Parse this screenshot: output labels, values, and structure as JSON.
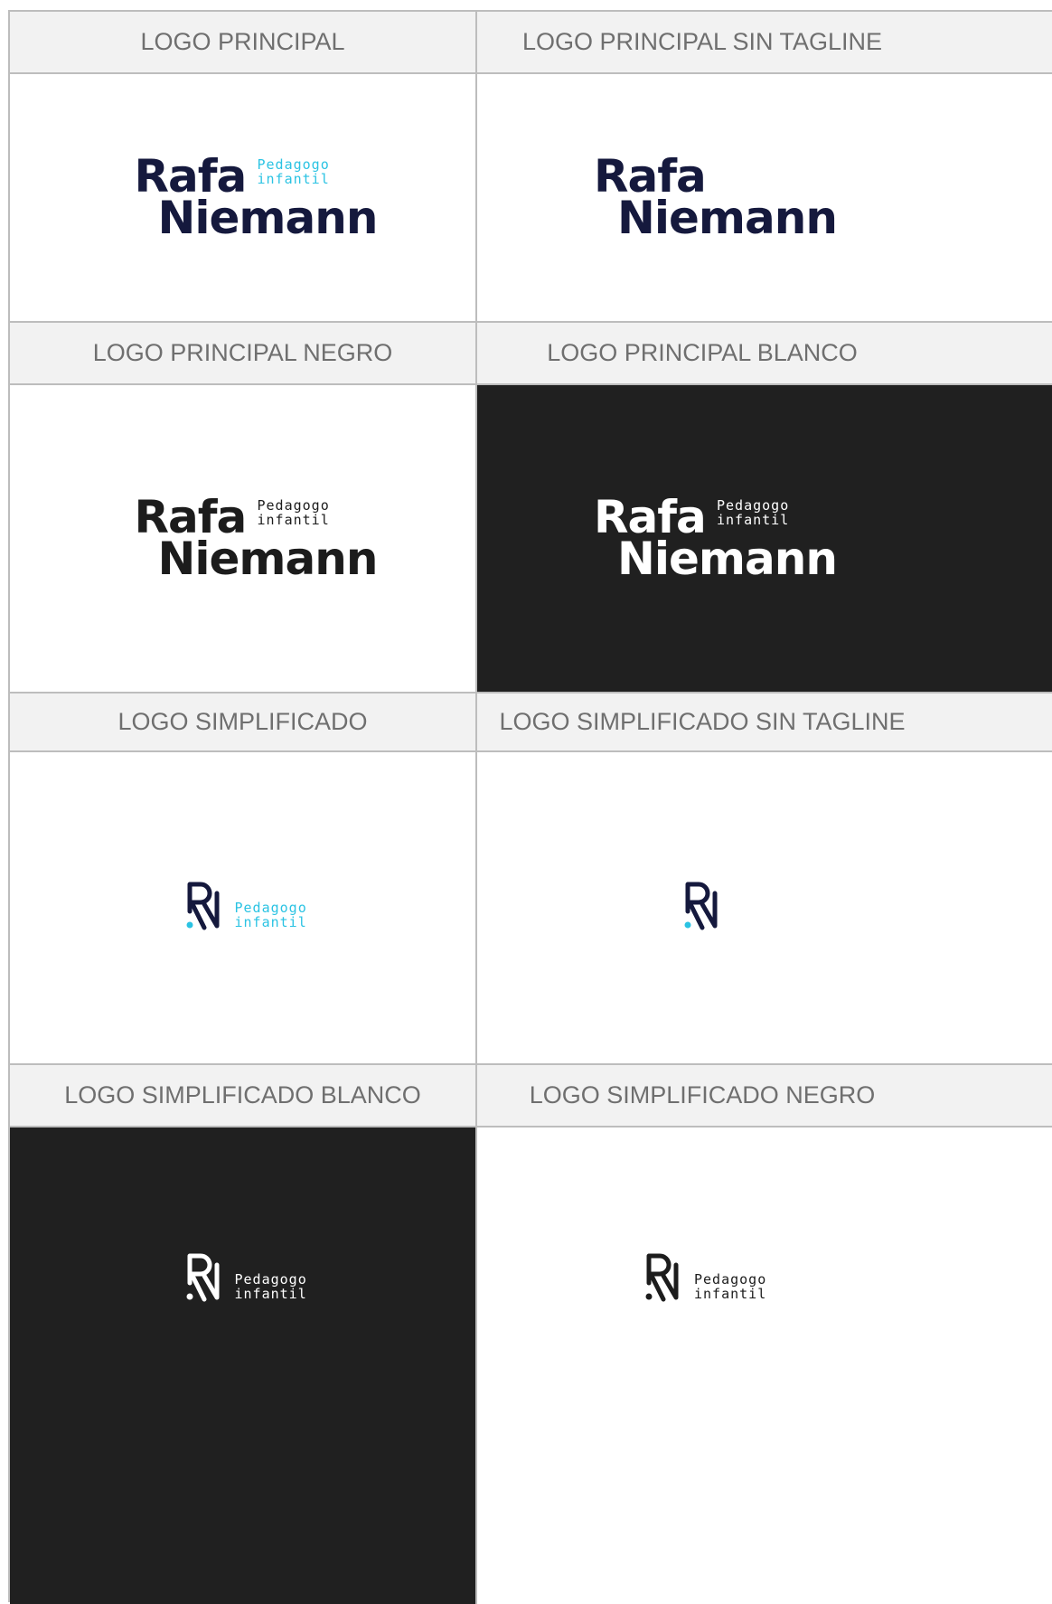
{
  "colors": {
    "navy": "#15193d",
    "cyan": "#2bc3e3",
    "black": "#1c1c1c",
    "white": "#ffffff",
    "dark_bg": "#202020",
    "header_bg": "#f2f2f2",
    "header_text": "#6f6f6f"
  },
  "logo_text": {
    "line1": "Rafa",
    "line2": "Niemann",
    "tag1": "Pedagogo",
    "tag2": "infantil"
  },
  "cells": [
    {
      "title": "LOGO PRINCIPAL"
    },
    {
      "title": "LOGO PRINCIPAL SIN TAGLINE"
    },
    {
      "title": "LOGO PRINCIPAL NEGRO"
    },
    {
      "title": "LOGO PRINCIPAL BLANCO"
    },
    {
      "title": "LOGO SIMPLIFICADO"
    },
    {
      "title": "LOGO SIMPLIFICADO SIN TAGLINE"
    },
    {
      "title": "LOGO SIMPLIFICADO BLANCO"
    },
    {
      "title": "LOGO SIMPLIFICADO NEGRO"
    }
  ]
}
